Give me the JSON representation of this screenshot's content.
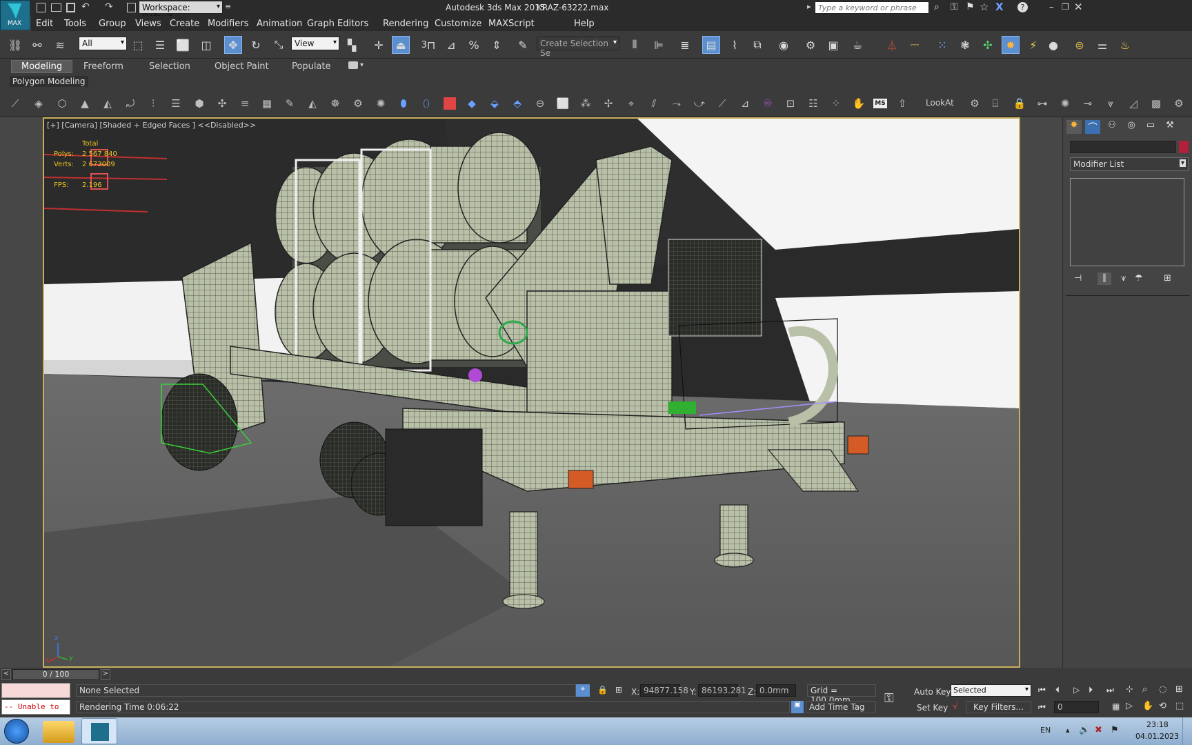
{
  "title_bar": {
    "app_title": "Autodesk 3ds Max  2015",
    "file_name": "KRAZ-63222.max",
    "workspace": "Workspace: Default",
    "search_placeholder": "Type a keyword or phrase",
    "logo_text": "MAX"
  },
  "menu": [
    "Edit",
    "Tools",
    "Group",
    "Views",
    "Create",
    "Modifiers",
    "Animation",
    "Graph Editors",
    "Rendering",
    "Customize",
    "MAXScript",
    "Help"
  ],
  "toolbar": {
    "filter_value": "All",
    "ref_coord_value": "View",
    "selection_set_placeholder": "Create Selection Se",
    "snap_label": "3"
  },
  "ribbon": {
    "tabs": [
      "Modeling",
      "Freeform",
      "Selection",
      "Object Paint",
      "Populate"
    ],
    "selected_tab": "Modeling",
    "panel_label": "Polygon Modeling",
    "lookat_label": "LookAt",
    "ms_label": "MS"
  },
  "viewport": {
    "label": "[+] [Camera] [Shaded + Edged Faces ]  <<Disabled>>",
    "stats": {
      "header": "Total",
      "polys_label": "Polys:",
      "polys_value": "2 567 840",
      "verts_label": "Verts:",
      "verts_value": "2 673009",
      "fps_label": "FPS:",
      "fps_value": "2.196"
    },
    "axis": {
      "x": "x",
      "y": "y",
      "z": "z"
    }
  },
  "command_panel": {
    "modifier_list": "Modifier List"
  },
  "timeline": {
    "frame_counter": "0 / 100"
  },
  "status": {
    "maxscript_listener": "-- Unable to",
    "selection_state": "None Selected",
    "rendering_time": "Rendering Time  0:06:22",
    "x_label": "X:",
    "x_value": "94877.158",
    "y_label": "Y:",
    "y_value": "86193.281",
    "z_label": "Z:",
    "z_value": "0.0mm",
    "grid": "Grid = 100.0mm",
    "add_time_tag": "Add Time Tag",
    "auto_key": "Auto Key",
    "set_key": "Set Key",
    "key_mode": "Selected",
    "key_filters": "Key Filters...",
    "frame_value": "0"
  },
  "taskbar": {
    "language": "EN",
    "time": "23:18",
    "date": "04.01.2023"
  },
  "colors": {
    "viewport_border": "#c9b15a",
    "selection_green": "#39d23a",
    "model_fill": "#b9c0a8",
    "stats_yellow": "#e8c61f"
  }
}
